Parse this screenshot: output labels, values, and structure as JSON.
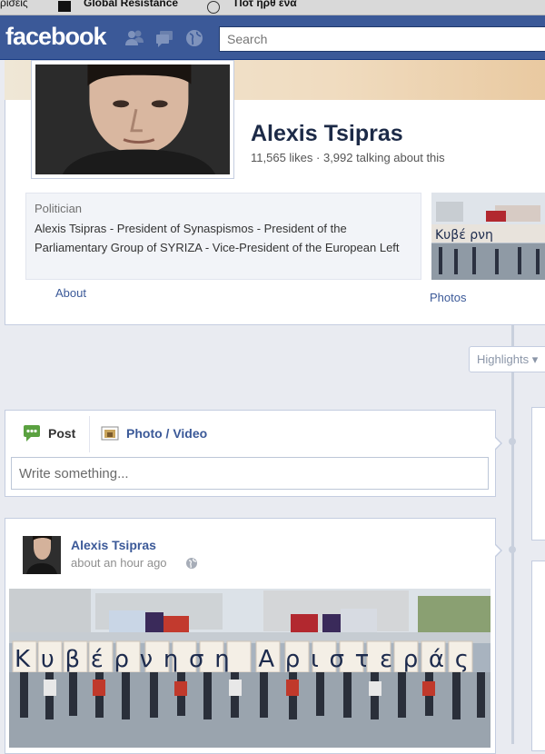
{
  "browser": {
    "bookmarks": [
      "ρίσεις",
      "Global Resistance",
      "Ποτ ήρθ ενα"
    ]
  },
  "header": {
    "logo": "facebook",
    "search_placeholder": "Search",
    "icons": [
      "friend-requests-icon",
      "messages-icon",
      "notifications-globe-icon"
    ],
    "brand_color": "#3b5998"
  },
  "profile": {
    "name": "Alexis Tsipras",
    "stats": "11,565 likes · 3,992 talking about this",
    "category": "Politician",
    "about": "Alexis Tsipras - President of Synaspismos - President of the Parliamentary Group of SYRIZA - Vice-President of the European Left",
    "about_link": "About",
    "photos_link": "Photos"
  },
  "timeline": {
    "highlights": "Highlights ▾"
  },
  "composer": {
    "tab_post": "Post",
    "tab_photo": "Photo / Video",
    "placeholder": "Write something..."
  },
  "post": {
    "author": "Alexis Tsipras",
    "time": "about an hour ago",
    "photo_text": "Κυβέρνηση Αριστεράς"
  }
}
